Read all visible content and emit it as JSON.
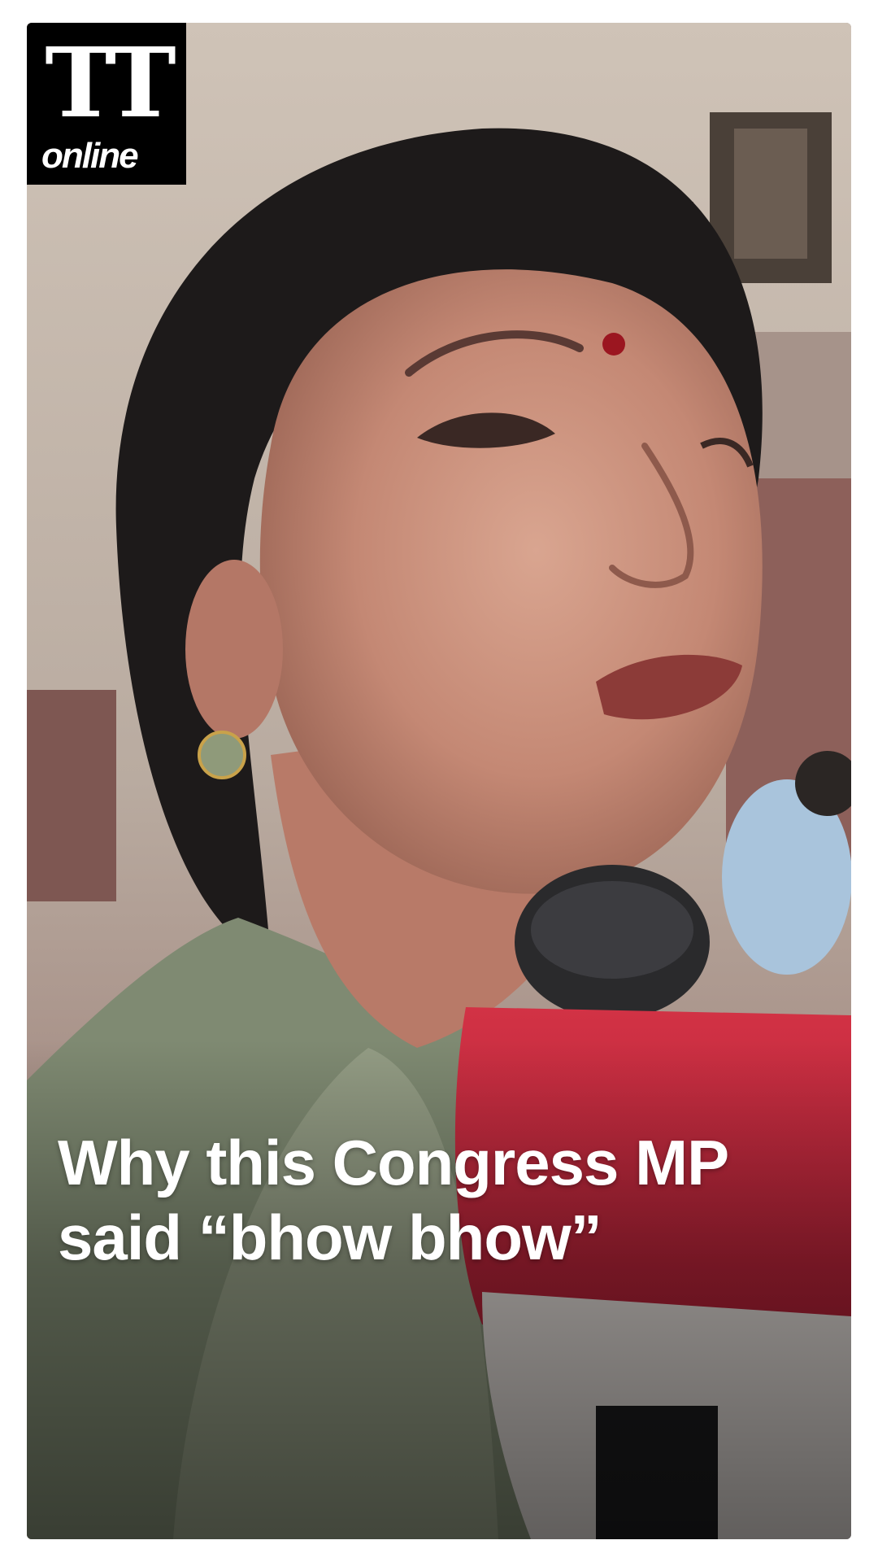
{
  "brand": {
    "logo_mark": "TT",
    "logo_sub": "online"
  },
  "headline": {
    "line1": "Why this Congress MP",
    "line2": "said “bhow bhow”"
  },
  "colors": {
    "logo_background": "#000000",
    "logo_text": "#ffffff",
    "headline_text": "#ffffff",
    "microphone_flag": "#c8283e"
  }
}
